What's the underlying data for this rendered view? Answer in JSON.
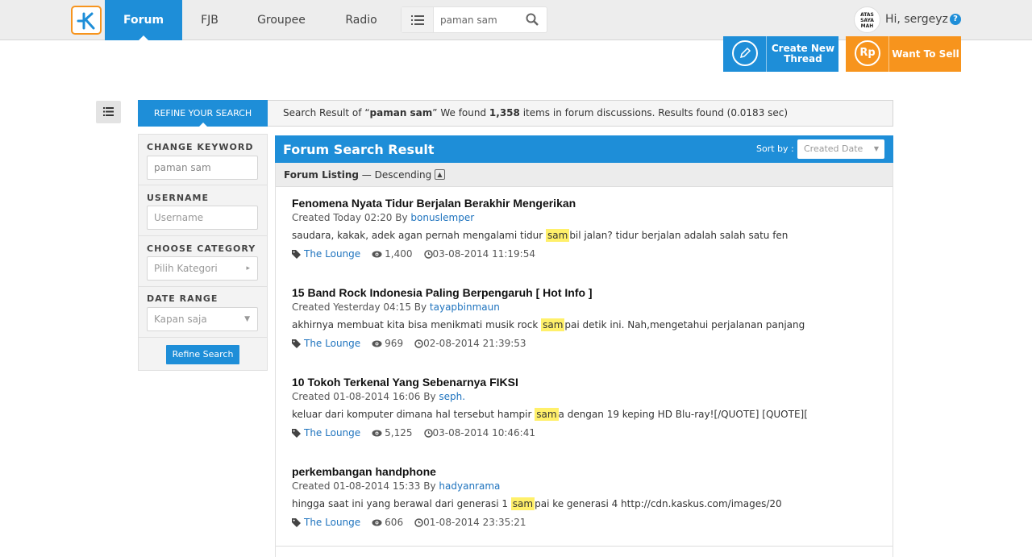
{
  "nav": {
    "tabs": [
      {
        "label": "Forum",
        "active": true
      },
      {
        "label": "FJB"
      },
      {
        "label": "Groupee"
      },
      {
        "label": "Radio"
      }
    ],
    "search_value": "paman sam",
    "avatar_text": [
      "ATAS",
      "SAYA",
      "MAH"
    ],
    "greeting": "Hi, sergeyz",
    "help_icon": "?"
  },
  "actions": {
    "create_label": "Create New Thread",
    "sell_label": "Want To Sell",
    "sell_icon_text": "Rp"
  },
  "refine": {
    "tab_label": "REFINE YOUR SEARCH",
    "result_prefix": "Search Result of “",
    "query": "paman sam",
    "result_mid": "” We found ",
    "count": "1,358",
    "result_suffix": " items in forum discussions. Results found (0.0183 sec)"
  },
  "filters": {
    "keyword_label": "CHANGE KEYWORD",
    "keyword_value": "paman sam",
    "username_label": "USERNAME",
    "username_placeholder": "Username",
    "category_label": "CHOOSE CATEGORY",
    "category_placeholder": "Pilih Kategori",
    "date_label": "DATE RANGE",
    "date_value": "Kapan saja",
    "button": "Refine Search"
  },
  "results": {
    "title": "Forum Search Result",
    "sort_label": "Sort by :",
    "sort_value": "Created Date",
    "listing_bold": "Forum Listing",
    "listing_rest": " — Descending",
    "items": [
      {
        "title": "Fenomena Nyata Tidur Berjalan Berakhir Mengerikan",
        "created": "Created Today 02:20 By ",
        "author": "bonuslemper",
        "snip_before": "saudara, kakak, adek agan pernah mengalami tidur ",
        "highlight": "sam",
        "snip_after": "bil jalan? tidur berjalan adalah salah satu fen",
        "category": "The Lounge",
        "views": "1,400",
        "last": "03-08-2014 11:19:54"
      },
      {
        "title": "15 Band Rock Indonesia Paling Berpengaruh [ Hot Info ]",
        "created": "Created Yesterday 04:15 By ",
        "author": "tayapbinmaun",
        "snip_before": "akhirnya membuat kita bisa menikmati musik rock ",
        "highlight": "sam",
        "snip_after": "pai detik ini. Nah,mengetahui perjalanan panjang",
        "category": "The Lounge",
        "views": "969",
        "last": "02-08-2014 21:39:53"
      },
      {
        "title": "10 Tokoh Terkenal Yang Sebenarnya FIKSI",
        "created": "Created 01-08-2014 16:06 By ",
        "author": "seph.",
        "snip_before": "keluar dari komputer dimana hal tersebut hampir ",
        "highlight": "sam",
        "snip_after": "a dengan 19 keping HD Blu-ray![/QUOTE] [QUOTE][",
        "category": "The Lounge",
        "views": "5,125",
        "last": "03-08-2014 10:46:41"
      },
      {
        "title": "perkembangan handphone",
        "created": "Created 01-08-2014 15:33 By ",
        "author": "hadyanrama",
        "snip_before": "hingga saat ini yang berawal dari generasi 1 ",
        "highlight": "sam",
        "snip_after": "pai ke generasi 4 http://cdn.kaskus.com/images/20",
        "category": "The Lounge",
        "views": "606",
        "last": "01-08-2014 23:35:21"
      }
    ]
  },
  "colors": {
    "primary": "#1e8ed8",
    "accent": "#f7941d",
    "highlight": "#fff06a"
  },
  "icons": [
    "kaskus-logo-icon",
    "list-icon",
    "search-icon",
    "pencil-icon",
    "rupiah-icon",
    "tag-icon",
    "eye-icon",
    "clock-icon",
    "help-icon",
    "caret-up-icon",
    "chevron-right-icon",
    "caret-down-icon"
  ]
}
